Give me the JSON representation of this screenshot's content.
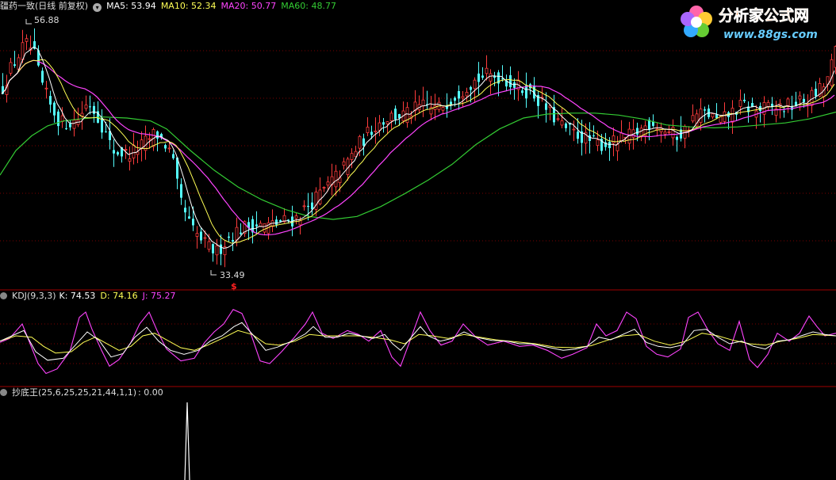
{
  "main_header": {
    "title": "疆药一致(日线 前复权)",
    "ma5": "MA5: 53.94",
    "ma10": "MA10: 52.34",
    "ma20": "MA20: 50.77",
    "ma60": "MA60: 48.77"
  },
  "kdj_header": {
    "title": "KDJ(9,3,3)",
    "k": "K: 74.53",
    "d": "D: 74.16",
    "j": "J: 75.27"
  },
  "cdw_header": {
    "title": "抄底王(25,6,25,25,21,44,1,1)",
    "value": ": 0.00"
  },
  "logo": {
    "title": "分析家公式网",
    "url": "www.88gs.com"
  },
  "annotations": {
    "high": "56.88",
    "low": "33.49",
    "signal": "$"
  },
  "colors": {
    "up": "#ff3c3c",
    "down": "#54ffff",
    "ma5": "#ffffff",
    "ma10": "#ffff55",
    "ma20": "#ff44ff",
    "ma60": "#33cc33",
    "grid": "#7a0000",
    "separator": "#a00000",
    "k": "#ffffff",
    "d": "#ffff55",
    "j": "#ff44ff"
  },
  "chart_data": [
    {
      "type": "candlestick",
      "ylim": [
        31,
        59
      ],
      "high_label": 56.88,
      "low_label": 33.49,
      "price_path": [
        [
          0,
          51
        ],
        [
          10,
          53
        ],
        [
          30,
          55.8
        ],
        [
          40,
          55.2
        ],
        [
          50,
          52
        ],
        [
          62,
          49.5
        ],
        [
          75,
          47.8
        ],
        [
          95,
          48
        ],
        [
          110,
          50
        ],
        [
          125,
          48
        ],
        [
          140,
          45
        ],
        [
          160,
          44.6
        ],
        [
          175,
          45.3
        ],
        [
          195,
          46.8
        ],
        [
          205,
          45.8
        ],
        [
          215,
          44.5
        ],
        [
          225,
          40
        ],
        [
          240,
          37
        ],
        [
          260,
          35.2
        ],
        [
          272,
          34.7
        ],
        [
          285,
          36
        ],
        [
          300,
          37
        ],
        [
          320,
          37.5
        ],
        [
          335,
          37.3
        ],
        [
          355,
          37.8
        ],
        [
          370,
          38
        ],
        [
          385,
          39.2
        ],
        [
          405,
          40.8
        ],
        [
          430,
          43
        ],
        [
          450,
          45.5
        ],
        [
          470,
          47.5
        ],
        [
          490,
          48.5
        ],
        [
          510,
          48.6
        ],
        [
          530,
          49.5
        ],
        [
          550,
          49.2
        ],
        [
          570,
          50.5
        ],
        [
          590,
          51.8
        ],
        [
          610,
          52.6
        ],
        [
          630,
          52.5
        ],
        [
          650,
          51.5
        ],
        [
          670,
          50.8
        ],
        [
          690,
          49
        ],
        [
          710,
          47.2
        ],
        [
          730,
          46.5
        ],
        [
          745,
          45.8
        ],
        [
          760,
          45.6
        ],
        [
          775,
          45.8
        ],
        [
          790,
          46.3
        ],
        [
          805,
          47
        ],
        [
          820,
          48
        ],
        [
          835,
          47.2
        ],
        [
          850,
          46.5
        ],
        [
          860,
          46.8
        ],
        [
          875,
          48.6
        ],
        [
          890,
          48.8
        ],
        [
          905,
          47.8
        ],
        [
          920,
          48.8
        ],
        [
          935,
          49.6
        ],
        [
          950,
          49
        ],
        [
          965,
          49.3
        ],
        [
          980,
          49.4
        ],
        [
          995,
          49.5
        ],
        [
          1010,
          50
        ],
        [
          1025,
          50.6
        ],
        [
          1040,
          51.8
        ],
        [
          1054,
          55.5
        ]
      ],
      "ma60_path": [
        [
          0,
          42.5
        ],
        [
          20,
          45
        ],
        [
          40,
          46.5
        ],
        [
          60,
          47.5
        ],
        [
          80,
          48
        ],
        [
          100,
          48.2
        ],
        [
          130,
          48.4
        ],
        [
          160,
          48.3
        ],
        [
          190,
          48
        ],
        [
          210,
          47.2
        ],
        [
          240,
          45
        ],
        [
          270,
          43
        ],
        [
          300,
          41.3
        ],
        [
          330,
          40
        ],
        [
          360,
          39
        ],
        [
          390,
          38.3
        ],
        [
          420,
          38
        ],
        [
          450,
          38.3
        ],
        [
          480,
          39.3
        ],
        [
          510,
          40.6
        ],
        [
          540,
          42
        ],
        [
          570,
          43.6
        ],
        [
          600,
          45.6
        ],
        [
          630,
          47.2
        ],
        [
          660,
          48.3
        ],
        [
          690,
          48.7
        ],
        [
          720,
          48.8
        ],
        [
          750,
          48.8
        ],
        [
          780,
          48.6
        ],
        [
          810,
          48.2
        ],
        [
          840,
          47.6
        ],
        [
          870,
          47.4
        ],
        [
          900,
          47.3
        ],
        [
          930,
          47.4
        ],
        [
          960,
          47.6
        ],
        [
          990,
          47.8
        ],
        [
          1020,
          48.2
        ],
        [
          1054,
          48.9
        ]
      ]
    },
    {
      "type": "line",
      "ylim": [
        -10,
        110
      ],
      "series": [
        {
          "name": "K",
          "last": 74.53
        },
        {
          "name": "D",
          "last": 74.16
        },
        {
          "name": "J",
          "last": 75.27
        }
      ],
      "k_path": [
        [
          0,
          54
        ],
        [
          15,
          62
        ],
        [
          30,
          70
        ],
        [
          45,
          38
        ],
        [
          60,
          25
        ],
        [
          80,
          28
        ],
        [
          95,
          48
        ],
        [
          110,
          68
        ],
        [
          125,
          55
        ],
        [
          140,
          30
        ],
        [
          155,
          35
        ],
        [
          170,
          60
        ],
        [
          185,
          75
        ],
        [
          200,
          54
        ],
        [
          215,
          40
        ],
        [
          232,
          34
        ],
        [
          250,
          40
        ],
        [
          265,
          54
        ],
        [
          280,
          62
        ],
        [
          295,
          76
        ],
        [
          305,
          82
        ],
        [
          320,
          62
        ],
        [
          335,
          40
        ],
        [
          350,
          45
        ],
        [
          370,
          55
        ],
        [
          385,
          65
        ],
        [
          395,
          76
        ],
        [
          410,
          60
        ],
        [
          425,
          60
        ],
        [
          440,
          66
        ],
        [
          455,
          62
        ],
        [
          470,
          58
        ],
        [
          485,
          64
        ],
        [
          495,
          50
        ],
        [
          505,
          40
        ],
        [
          520,
          62
        ],
        [
          530,
          76
        ],
        [
          540,
          62
        ],
        [
          555,
          54
        ],
        [
          570,
          58
        ],
        [
          585,
          68
        ],
        [
          600,
          60
        ],
        [
          620,
          55
        ],
        [
          640,
          54
        ],
        [
          655,
          50
        ],
        [
          670,
          50
        ],
        [
          690,
          45
        ],
        [
          710,
          40
        ],
        [
          725,
          42
        ],
        [
          740,
          46
        ],
        [
          755,
          60
        ],
        [
          770,
          56
        ],
        [
          785,
          64
        ],
        [
          800,
          72
        ],
        [
          815,
          52
        ],
        [
          830,
          46
        ],
        [
          845,
          44
        ],
        [
          860,
          48
        ],
        [
          875,
          70
        ],
        [
          890,
          72
        ],
        [
          905,
          60
        ],
        [
          920,
          50
        ],
        [
          935,
          54
        ],
        [
          950,
          46
        ],
        [
          965,
          42
        ],
        [
          980,
          54
        ],
        [
          995,
          56
        ],
        [
          1010,
          62
        ],
        [
          1025,
          68
        ],
        [
          1040,
          64
        ],
        [
          1054,
          62
        ]
      ],
      "d_path": [
        [
          0,
          54
        ],
        [
          20,
          62
        ],
        [
          40,
          60
        ],
        [
          55,
          46
        ],
        [
          70,
          36
        ],
        [
          90,
          38
        ],
        [
          105,
          52
        ],
        [
          120,
          60
        ],
        [
          135,
          50
        ],
        [
          150,
          40
        ],
        [
          165,
          46
        ],
        [
          180,
          62
        ],
        [
          195,
          66
        ],
        [
          210,
          56
        ],
        [
          228,
          44
        ],
        [
          245,
          40
        ],
        [
          262,
          48
        ],
        [
          280,
          58
        ],
        [
          300,
          70
        ],
        [
          318,
          64
        ],
        [
          335,
          50
        ],
        [
          352,
          48
        ],
        [
          372,
          54
        ],
        [
          390,
          64
        ],
        [
          408,
          62
        ],
        [
          428,
          62
        ],
        [
          450,
          62
        ],
        [
          470,
          60
        ],
        [
          492,
          56
        ],
        [
          510,
          50
        ],
        [
          528,
          64
        ],
        [
          545,
          62
        ],
        [
          565,
          58
        ],
        [
          585,
          64
        ],
        [
          605,
          60
        ],
        [
          625,
          56
        ],
        [
          650,
          53
        ],
        [
          675,
          50
        ],
        [
          700,
          45
        ],
        [
          725,
          44
        ],
        [
          745,
          47
        ],
        [
          765,
          55
        ],
        [
          785,
          62
        ],
        [
          805,
          64
        ],
        [
          825,
          54
        ],
        [
          845,
          48
        ],
        [
          865,
          54
        ],
        [
          885,
          66
        ],
        [
          905,
          62
        ],
        [
          925,
          55
        ],
        [
          945,
          50
        ],
        [
          965,
          48
        ],
        [
          985,
          54
        ],
        [
          1005,
          58
        ],
        [
          1025,
          64
        ],
        [
          1054,
          62
        ]
      ],
      "j_path": [
        [
          0,
          52
        ],
        [
          12,
          58
        ],
        [
          28,
          80
        ],
        [
          38,
          50
        ],
        [
          48,
          20
        ],
        [
          58,
          5
        ],
        [
          72,
          12
        ],
        [
          88,
          38
        ],
        [
          100,
          90
        ],
        [
          108,
          98
        ],
        [
          116,
          72
        ],
        [
          128,
          40
        ],
        [
          138,
          16
        ],
        [
          150,
          26
        ],
        [
          165,
          52
        ],
        [
          176,
          80
        ],
        [
          188,
          98
        ],
        [
          198,
          70
        ],
        [
          210,
          42
        ],
        [
          228,
          24
        ],
        [
          245,
          28
        ],
        [
          258,
          52
        ],
        [
          270,
          68
        ],
        [
          282,
          80
        ],
        [
          294,
          102
        ],
        [
          305,
          96
        ],
        [
          316,
          66
        ],
        [
          328,
          24
        ],
        [
          340,
          20
        ],
        [
          355,
          38
        ],
        [
          370,
          58
        ],
        [
          385,
          80
        ],
        [
          394,
          98
        ],
        [
          406,
          66
        ],
        [
          420,
          58
        ],
        [
          438,
          70
        ],
        [
          452,
          64
        ],
        [
          465,
          54
        ],
        [
          480,
          70
        ],
        [
          494,
          30
        ],
        [
          505,
          16
        ],
        [
          518,
          58
        ],
        [
          530,
          98
        ],
        [
          542,
          70
        ],
        [
          556,
          48
        ],
        [
          570,
          54
        ],
        [
          584,
          80
        ],
        [
          600,
          60
        ],
        [
          615,
          48
        ],
        [
          635,
          54
        ],
        [
          655,
          46
        ],
        [
          672,
          48
        ],
        [
          690,
          40
        ],
        [
          708,
          28
        ],
        [
          722,
          34
        ],
        [
          740,
          44
        ],
        [
          752,
          80
        ],
        [
          764,
          62
        ],
        [
          778,
          70
        ],
        [
          790,
          98
        ],
        [
          802,
          88
        ],
        [
          815,
          46
        ],
        [
          828,
          34
        ],
        [
          842,
          30
        ],
        [
          858,
          42
        ],
        [
          868,
          90
        ],
        [
          880,
          98
        ],
        [
          893,
          70
        ],
        [
          905,
          50
        ],
        [
          920,
          40
        ],
        [
          932,
          84
        ],
        [
          945,
          26
        ],
        [
          955,
          14
        ],
        [
          968,
          34
        ],
        [
          980,
          66
        ],
        [
          995,
          54
        ],
        [
          1008,
          66
        ],
        [
          1020,
          92
        ],
        [
          1030,
          76
        ],
        [
          1040,
          62
        ],
        [
          1054,
          66
        ]
      ]
    },
    {
      "type": "bar",
      "series": [
        {
          "name": "抄底王",
          "last": 0.0
        }
      ],
      "spike_x": 236,
      "ylim": [
        0,
        1
      ]
    }
  ]
}
